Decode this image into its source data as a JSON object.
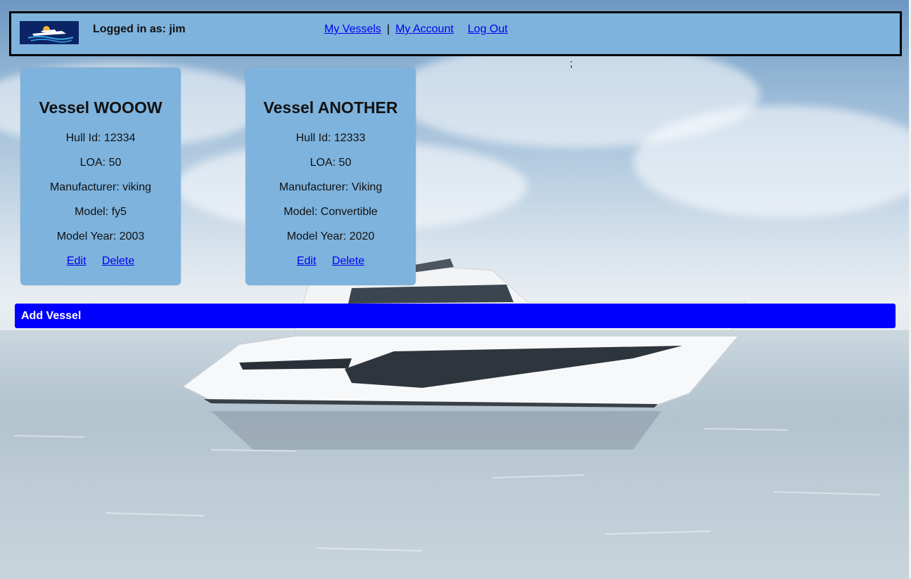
{
  "header": {
    "logged_in_text": "Logged in as: jim",
    "nav": {
      "my_vessels": "My Vessels",
      "separator": "|",
      "my_account": "My Account",
      "log_out": "Log Out"
    },
    "stray_char": ";"
  },
  "vessels": [
    {
      "title": "Vessel WOOOW",
      "hull_id": "Hull Id: 12334",
      "loa": "LOA: 50",
      "manufacturer": "Manufacturer: viking",
      "model": "Model: fy5",
      "model_year": "Model Year: 2003",
      "edit_label": "Edit",
      "delete_label": "Delete"
    },
    {
      "title": "Vessel ANOTHER",
      "hull_id": "Hull Id: 12333",
      "loa": "LOA: 50",
      "manufacturer": "Manufacturer: Viking",
      "model": "Model: Convertible",
      "model_year": "Model Year: 2020",
      "edit_label": "Edit",
      "delete_label": "Delete"
    }
  ],
  "add_vessel_label": "Add Vessel",
  "colors": {
    "panel": "#7eb3dd",
    "link": "#0000ee",
    "add_bar": "#0000ff",
    "logo_bg": "#0b2466"
  },
  "icons": {
    "logo": "yacht-logo-icon",
    "background": "yacht-photo"
  }
}
